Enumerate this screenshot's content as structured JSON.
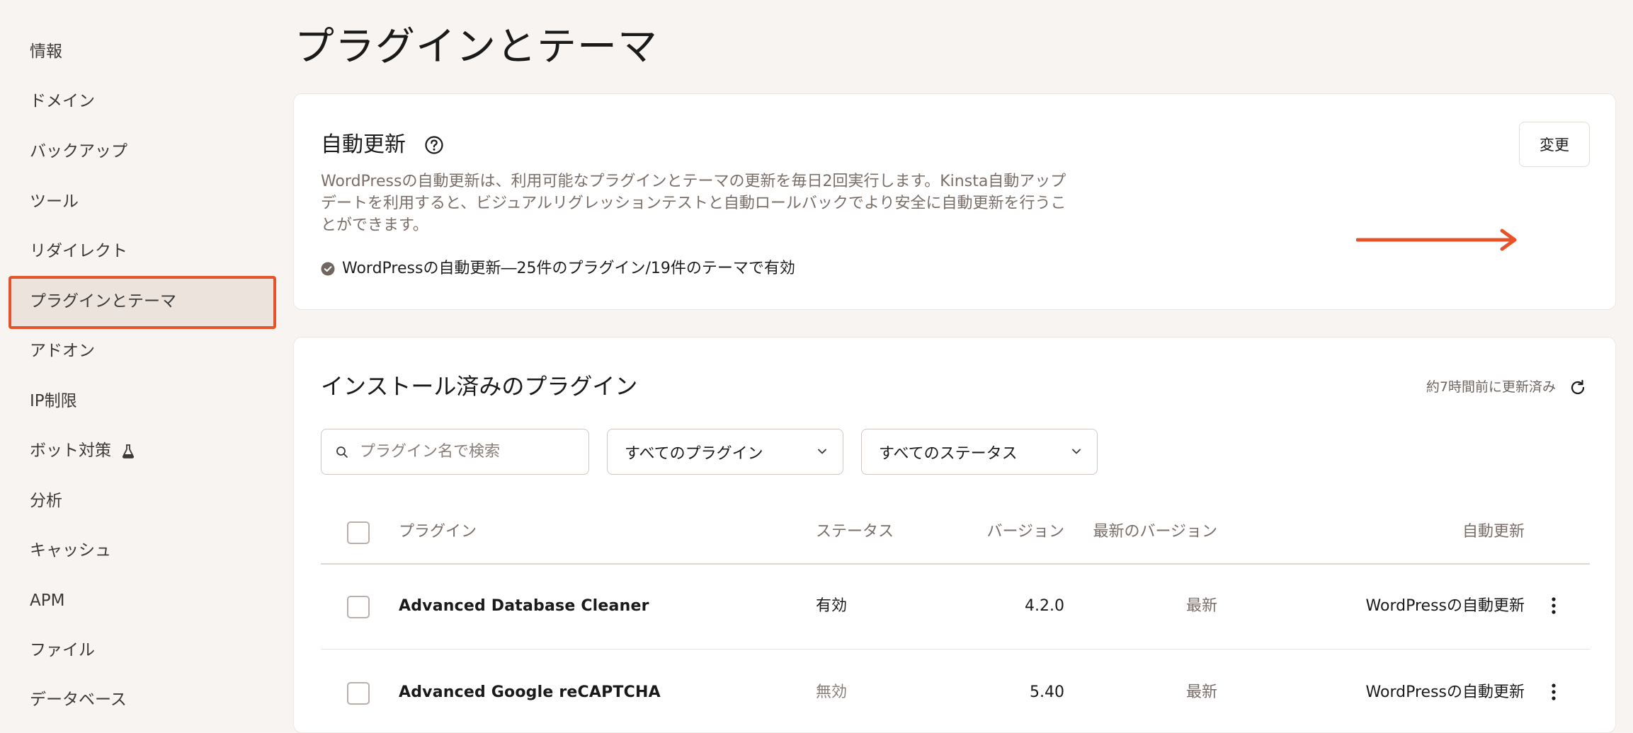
{
  "sidebar": {
    "items": [
      {
        "label": "情報"
      },
      {
        "label": "ドメイン"
      },
      {
        "label": "バックアップ"
      },
      {
        "label": "ツール"
      },
      {
        "label": "リダイレクト"
      },
      {
        "label": "プラグインとテーマ",
        "active": true
      },
      {
        "label": "アドオン"
      },
      {
        "label": "IP制限"
      },
      {
        "label": "ボット対策",
        "icon": "flask-icon"
      },
      {
        "label": "分析"
      },
      {
        "label": "キャッシュ"
      },
      {
        "label": "APM"
      },
      {
        "label": "ファイル"
      },
      {
        "label": "データベース"
      }
    ]
  },
  "page": {
    "title": "プラグインとテーマ"
  },
  "auto_update": {
    "title": "自動更新",
    "description": "WordPressの自動更新は、利用可能なプラグインとテーマの更新を毎日2回実行します。Kinsta自動アップデートを利用すると、ビジュアルリグレッションテストと自動ロールバックでより安全に自動更新を行うことができます。",
    "status": "WordPressの自動更新―25件のプラグイン/19件のテーマで有効",
    "change_button": "変更"
  },
  "plugins": {
    "title": "インストール済みのプラグイン",
    "updated": "約7時間前に更新済み",
    "search_placeholder": "プラグイン名で検索",
    "filter_type": "すべてのプラグイン",
    "filter_status": "すべてのステータス",
    "columns": {
      "plugin": "プラグイン",
      "status": "ステータス",
      "version": "バージョン",
      "latest": "最新のバージョン",
      "auto_update": "自動更新"
    },
    "rows": [
      {
        "name": "Advanced Database Cleaner",
        "status": "有効",
        "version": "4.2.0",
        "latest": "最新",
        "auto_update": "WordPressの自動更新"
      },
      {
        "name": "Advanced Google reCAPTCHA",
        "status": "無効",
        "version": "5.40",
        "latest": "最新",
        "auto_update": "WordPressの自動更新"
      }
    ]
  },
  "colors": {
    "accent": "#e5532a",
    "background": "#f7f4f2",
    "active_item_bg": "#ebe3dc"
  }
}
